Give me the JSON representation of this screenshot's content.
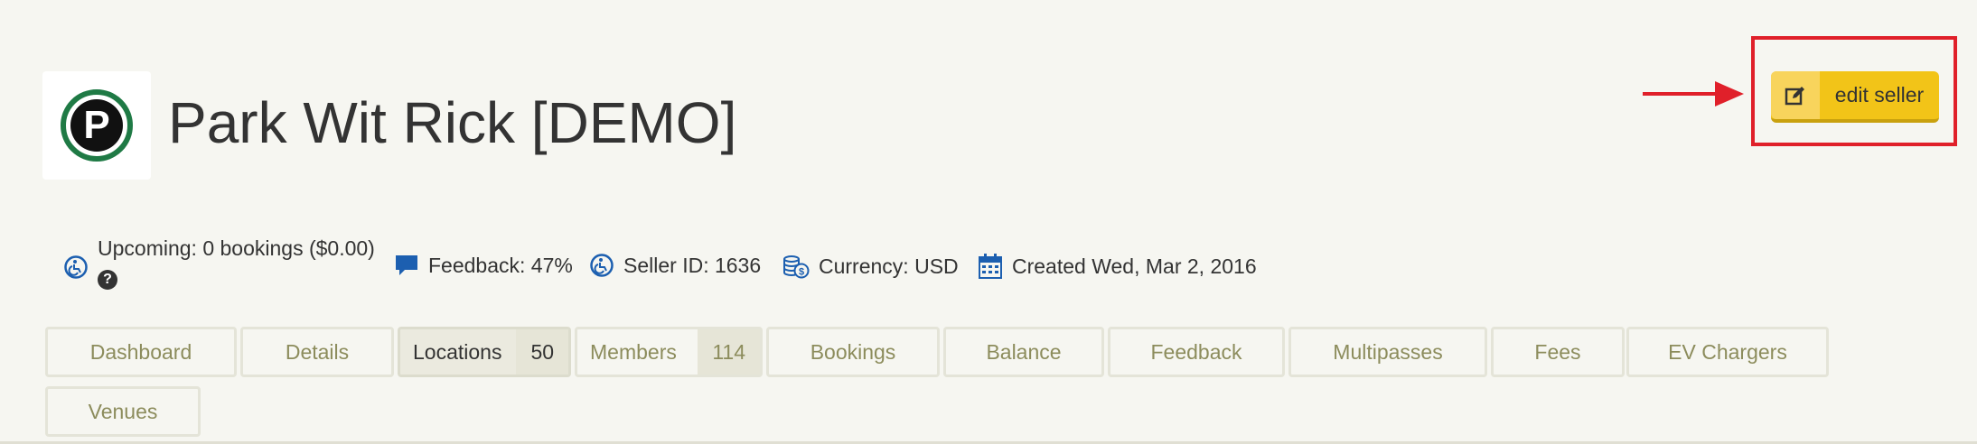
{
  "header": {
    "logo_letter": "P",
    "seller_name": "Park Wit Rick [DEMO]",
    "edit_button_label": "edit seller"
  },
  "info": {
    "upcoming": "Upcoming: 0 bookings ($0.00)",
    "help": "?",
    "feedback": "Feedback: 47%",
    "seller_id": "Seller ID: 1636",
    "currency": "Currency: USD",
    "created": "Created Wed, Mar 2, 2016"
  },
  "tabs": [
    {
      "label": "Dashboard"
    },
    {
      "label": "Details"
    },
    {
      "label": "Locations",
      "count": "50",
      "active": true
    },
    {
      "label": "Members",
      "count": "114"
    },
    {
      "label": "Bookings"
    },
    {
      "label": "Balance"
    },
    {
      "label": "Feedback"
    },
    {
      "label": "Multipasses"
    },
    {
      "label": "Fees"
    },
    {
      "label": "EV Chargers"
    },
    {
      "label": "Venues"
    }
  ],
  "colors": {
    "accent_button": "#f2c418",
    "annotation": "#e0202a",
    "icon_blue": "#1c5fb0",
    "logo_green": "#1f7a45"
  },
  "icons": {
    "edit": "edit-icon",
    "upcoming": "accessible-icon",
    "feedback": "chat-bubble-icon",
    "seller_id": "accessible-icon",
    "currency": "coins-icon",
    "created": "calendar-icon"
  }
}
